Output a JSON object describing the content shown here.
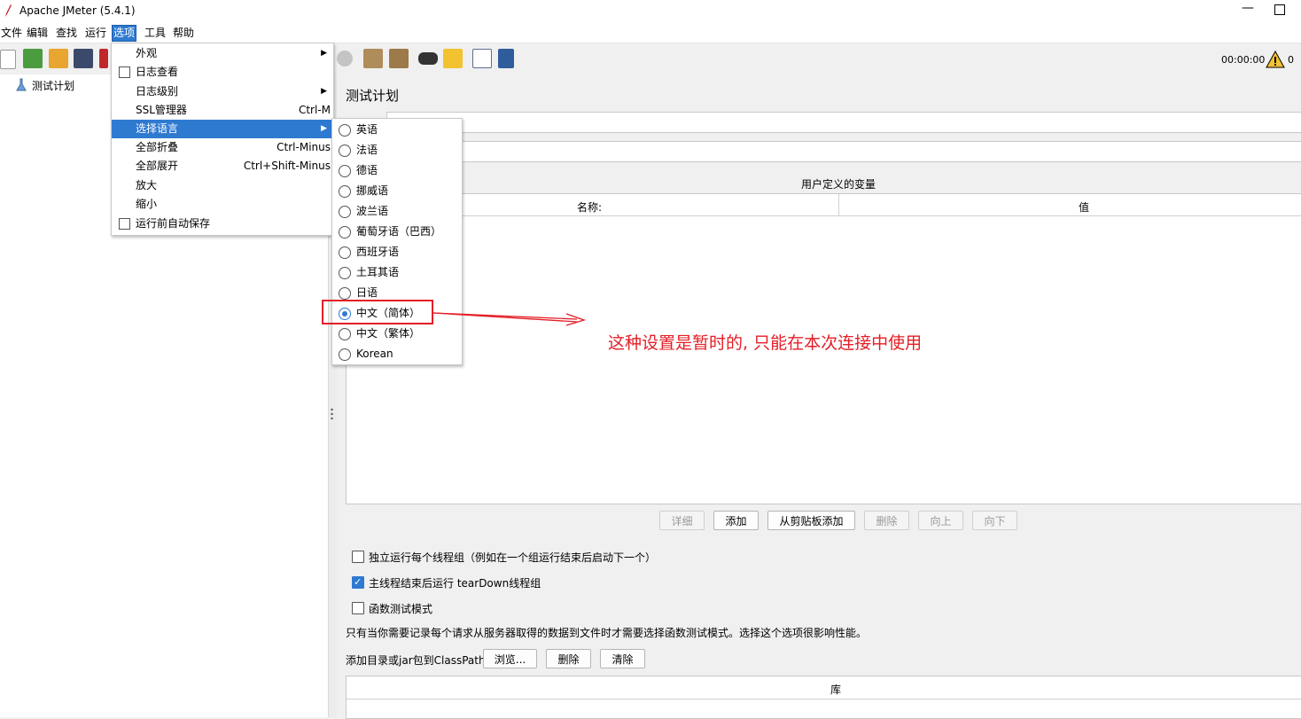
{
  "window": {
    "title": "Apache JMeter (5.4.1)",
    "minimize_glyph": "—",
    "colors": {
      "accent": "#2f7ad1",
      "annotation": "#e41e26"
    }
  },
  "menubar": [
    {
      "label": "文件"
    },
    {
      "label": "编辑"
    },
    {
      "label": "查找"
    },
    {
      "label": "运行"
    },
    {
      "label": "选项"
    },
    {
      "label": "工具"
    },
    {
      "label": "帮助"
    }
  ],
  "toolbar": {
    "timer": "00:00:00",
    "warning_count": "0"
  },
  "tree": {
    "root": "测试计划"
  },
  "options_menu": {
    "items": [
      {
        "label": "外观",
        "accel": ""
      },
      {
        "label": "日志查看",
        "accel": ""
      },
      {
        "label": "日志级别",
        "accel": ""
      },
      {
        "label": "SSL管理器",
        "accel": "Ctrl-M"
      },
      {
        "label": "选择语言",
        "accel": ""
      },
      {
        "label": "全部折叠",
        "accel": "Ctrl-Minus"
      },
      {
        "label": "全部展开",
        "accel": "Ctrl+Shift-Minus"
      },
      {
        "label": "放大",
        "accel": ""
      },
      {
        "label": "缩小",
        "accel": ""
      },
      {
        "label": "运行前自动保存",
        "accel": ""
      }
    ],
    "highlighted": "选择语言"
  },
  "language_menu": {
    "items": [
      {
        "label": "英语"
      },
      {
        "label": "法语"
      },
      {
        "label": "德语"
      },
      {
        "label": "挪威语"
      },
      {
        "label": "波兰语"
      },
      {
        "label": "葡萄牙语（巴西）"
      },
      {
        "label": "西班牙语"
      },
      {
        "label": "土耳其语"
      },
      {
        "label": "日语"
      },
      {
        "label": "中文（简体）"
      },
      {
        "label": "中文（繁体）"
      },
      {
        "label": "Korean"
      }
    ],
    "selected": "中文（简体）"
  },
  "panel": {
    "title": "测试计划",
    "udv_title": "用户定义的变量",
    "columns": [
      "名称:",
      "值"
    ],
    "buttons": [
      {
        "label": "详细",
        "enabled": false
      },
      {
        "label": "添加",
        "enabled": true
      },
      {
        "label": "从剪贴板添加",
        "enabled": true
      },
      {
        "label": "删除",
        "enabled": false
      },
      {
        "label": "向上",
        "enabled": false
      },
      {
        "label": "向下",
        "enabled": false
      }
    ],
    "checkboxes": [
      {
        "label": "独立运行每个线程组（例如在一个组运行结束后启动下一个）",
        "checked": false
      },
      {
        "label": "主线程结束后运行 tearDown线程组",
        "checked": true
      },
      {
        "label": "函数测试模式",
        "checked": false
      }
    ],
    "note": "只有当你需要记录每个请求从服务器取得的数据到文件时才需要选择函数测试模式。选择这个选项很影响性能。",
    "classpath_label": "添加目录或jar包到ClassPath",
    "classpath_buttons": [
      "浏览...",
      "删除",
      "清除"
    ],
    "lib_header": "库"
  },
  "annotation": {
    "text": "这种设置是暂时的, 只能在本次连接中使用"
  }
}
